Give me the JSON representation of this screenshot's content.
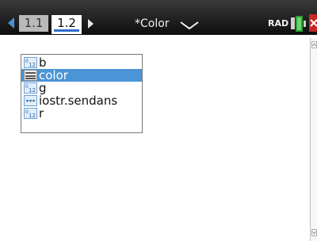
{
  "tabs": [
    {
      "label": "1.1",
      "active": false
    },
    {
      "label": "1.2",
      "active": true
    }
  ],
  "document": {
    "title": "*Color"
  },
  "status": {
    "mode": "RAD",
    "battery_icon": "battery-icon",
    "close_icon": "close-icon"
  },
  "variables": [
    {
      "name": "b",
      "type_icon": "number-type-icon"
    },
    {
      "name": "color",
      "type_icon": "matrix-type-icon",
      "selected": true
    },
    {
      "name": "g",
      "type_icon": "number-type-icon"
    },
    {
      "name": "iostr.sendans",
      "type_icon": "string-type-icon"
    },
    {
      "name": "r",
      "type_icon": "number-type-icon"
    }
  ],
  "colors": {
    "accent": "#4b95d6",
    "topbar": "#1a1a1a",
    "close": "#c62828",
    "battery": "#2e9e33"
  }
}
